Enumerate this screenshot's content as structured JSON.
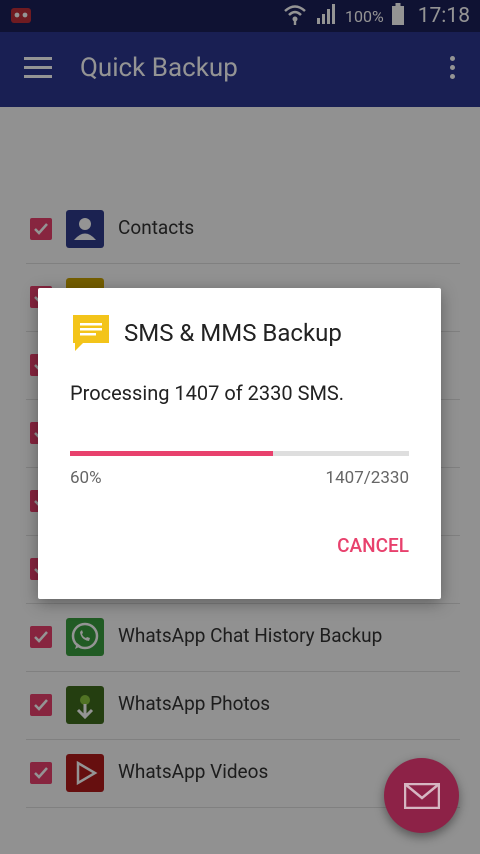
{
  "status_bar": {
    "battery_percent": "100%",
    "time": "17:18"
  },
  "app_bar": {
    "title": "Quick Backup"
  },
  "list": {
    "items": [
      {
        "label": "Contacts",
        "icon": "contacts-icon",
        "checked": true
      },
      {
        "label": "",
        "icon": "calendar-icon",
        "checked": true
      },
      {
        "label": "",
        "icon": "item-icon",
        "checked": true
      },
      {
        "label": "",
        "icon": "item-icon",
        "checked": true
      },
      {
        "label": "",
        "icon": "item-icon",
        "checked": true
      },
      {
        "label": "",
        "icon": "item-icon",
        "checked": true
      },
      {
        "label": "WhatsApp Chat History Backup",
        "icon": "whatsapp-icon",
        "checked": true
      },
      {
        "label": "WhatsApp Photos",
        "icon": "photo-icon",
        "checked": true
      },
      {
        "label": "WhatsApp Videos",
        "icon": "video-icon",
        "checked": true
      }
    ]
  },
  "dialog": {
    "title": "SMS & MMS Backup",
    "message": "Processing 1407 of 2330 SMS.",
    "progress_percent": "60%",
    "progress_count": "1407/2330",
    "progress_fraction": 0.6,
    "cancel_label": "CANCEL"
  },
  "colors": {
    "accent": "#e8416d",
    "appbar": "#2c3690",
    "statusbar": "#1b1f59",
    "dialog_icon": "#f3c41a"
  }
}
